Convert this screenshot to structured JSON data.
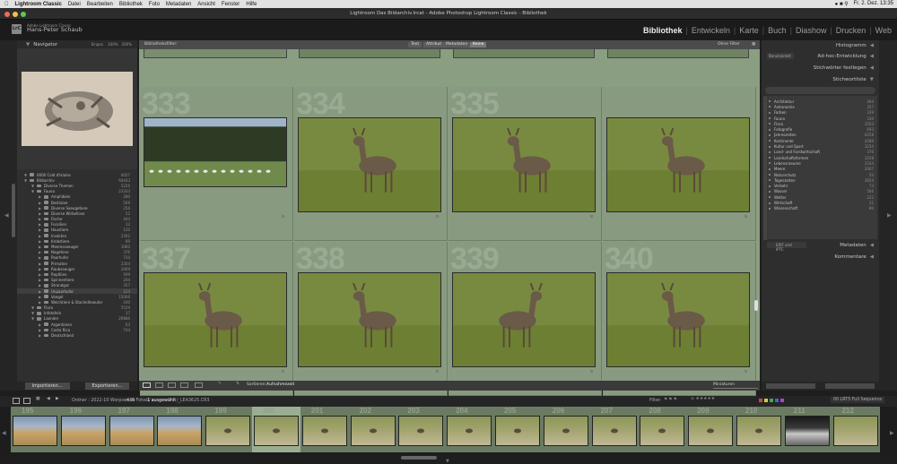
{
  "menubar": {
    "app": "Lightroom Classic",
    "items": [
      "Datei",
      "Bearbeiten",
      "Bibliothek",
      "Foto",
      "Metadaten",
      "Ansicht",
      "Fenster",
      "Hilfe"
    ],
    "datetime": "Fr. 2. Dez. 13:35"
  },
  "window": {
    "title": "Lightroom Das Bildarchiv.lrcat - Adobe Photoshop Lightroom Classic - Bibliothek"
  },
  "identity": {
    "app_line": "Adobe Lightroom Classic",
    "user_name": "Hans-Peter Schaub",
    "logo": "LrC"
  },
  "modules": [
    "Bibliothek",
    "Entwickeln",
    "Karte",
    "Buch",
    "Diashow",
    "Drucken",
    "Web"
  ],
  "navigator": {
    "title": "Navigator",
    "zoom_options": [
      "Einpas.",
      "100%",
      "200%"
    ]
  },
  "collections": [
    {
      "label": "0000 Cold d'Islaise",
      "count": "6057",
      "level": 0
    },
    {
      "label": "Bildarchiv",
      "count": "64443",
      "level": 0
    },
    {
      "label": "Diverse Themen",
      "count": "5226",
      "level": 1
    },
    {
      "label": "Fauna",
      "count": "23333",
      "level": 1
    },
    {
      "label": "Amphibien",
      "count": "280",
      "level": 2
    },
    {
      "label": "Bestiolae",
      "count": "569",
      "level": 2
    },
    {
      "label": "Diverse Saeugetiere",
      "count": "256",
      "level": 2
    },
    {
      "label": "Diverse Wirbellose",
      "count": "52",
      "level": 2
    },
    {
      "label": "Fische",
      "count": "444",
      "level": 2
    },
    {
      "label": "Fossilien",
      "count": "12",
      "level": 2
    },
    {
      "label": "Haustiere",
      "count": "120",
      "level": 2
    },
    {
      "label": "Insekten",
      "count": "2392",
      "level": 2
    },
    {
      "label": "Krebstiere",
      "count": "89",
      "level": 2
    },
    {
      "label": "Meeressaeuger",
      "count": "1060",
      "level": 2
    },
    {
      "label": "Nagetiere",
      "count": "376",
      "level": 2
    },
    {
      "label": "Paarhufer",
      "count": "720",
      "level": 2
    },
    {
      "label": "Primaten",
      "count": "2304",
      "level": 2
    },
    {
      "label": "Raubsaeuger",
      "count": "2069",
      "level": 2
    },
    {
      "label": "Reptilien",
      "count": "599",
      "level": 2
    },
    {
      "label": "Spinnentiere",
      "count": "204",
      "level": 2
    },
    {
      "label": "Strandgut",
      "count": "357",
      "level": 2
    },
    {
      "label": "Unpaarhufer",
      "count": "224",
      "level": 2
    },
    {
      "label": "Voegel",
      "count": "15006",
      "level": 2
    },
    {
      "label": "Weichtiere & Stachelhaeuter",
      "count": "240",
      "level": 2
    },
    {
      "label": "Flora",
      "count": "5529",
      "level": 1
    },
    {
      "label": "Infotafeln",
      "count": "37",
      "level": 1
    },
    {
      "label": "Laender",
      "count": "29886",
      "level": 1
    },
    {
      "label": "Argentinien",
      "count": "63",
      "level": 2
    },
    {
      "label": "Costa Rica",
      "count": "744",
      "level": 2
    },
    {
      "label": "Deutschland",
      "count": "",
      "level": 2
    }
  ],
  "left_buttons": {
    "import": "Importieren...",
    "export": "Exportieren..."
  },
  "filterbar": {
    "label": "Bibliotheksfilter:",
    "tabs": [
      "Text",
      "Attribut",
      "Metadaten",
      "Keine"
    ],
    "active": "Keine",
    "preset": "Ohne Filter"
  },
  "grid": {
    "row_numbers": [
      "333",
      "334",
      "335",
      "",
      "337",
      "338",
      "339",
      "340"
    ]
  },
  "toolbar": {
    "sort_label": "Sortieren:",
    "sort_value": "Aufnahmezeit",
    "thumb_label": "Miniaturen"
  },
  "right": {
    "histogram": "Histogramm",
    "quick_dev": "Ad-hoc-Entwicklung",
    "keyword_set": "Stichwörter festlegen",
    "keyword_list": "Stichwortliste",
    "metadata": "Metadaten",
    "comments": "Kommentare",
    "default_preset": "Benutzerdef.",
    "exif_preset": "EXIF und IPTC",
    "keywords": [
      {
        "label": "Architektur",
        "count": "494"
      },
      {
        "label": "Astronomie",
        "count": "357"
      },
      {
        "label": "Farben",
        "count": "339"
      },
      {
        "label": "Fauna",
        "count": "330"
      },
      {
        "label": "Flora",
        "count": "3563"
      },
      {
        "label": "Fotografie",
        "count": "693"
      },
      {
        "label": "Jahreszeiten",
        "count": "6258"
      },
      {
        "label": "Kontinente",
        "count": "4289"
      },
      {
        "label": "Kultur und Sport",
        "count": "3234"
      },
      {
        "label": "Land- und Forstwirtschaft",
        "count": "376"
      },
      {
        "label": "Landschaftsformen",
        "count": "3258"
      },
      {
        "label": "Lebensraeume",
        "count": "3334"
      },
      {
        "label": "Meere",
        "count": "2007"
      },
      {
        "label": "Naturschutz",
        "count": "50"
      },
      {
        "label": "Tageszeiten",
        "count": "3654"
      },
      {
        "label": "Verkehr",
        "count": "73"
      },
      {
        "label": "Wasser",
        "count": "566"
      },
      {
        "label": "Wetter",
        "count": "222"
      },
      {
        "label": "Wirtschaft",
        "count": "31"
      },
      {
        "label": "Wissenschaft",
        "count": "80"
      }
    ]
  },
  "filmstrip": {
    "source": "Ordner : 2022-10 Worpswede",
    "info": "436 Fotos /",
    "selected": "1 ausgewählt",
    "file": "/_LEA3625.CR3",
    "filter_label": "Filter:",
    "filter_preset": "00 LRT5 Full Sequence",
    "numbers": [
      "195",
      "196",
      "197",
      "198",
      "199",
      "200",
      "201",
      "202",
      "203",
      "204",
      "205",
      "206",
      "207",
      "208",
      "209",
      "210",
      "211",
      "212"
    ]
  },
  "colors": {
    "grid_bg": "#8a9e82",
    "accent_text": "#ececec"
  }
}
